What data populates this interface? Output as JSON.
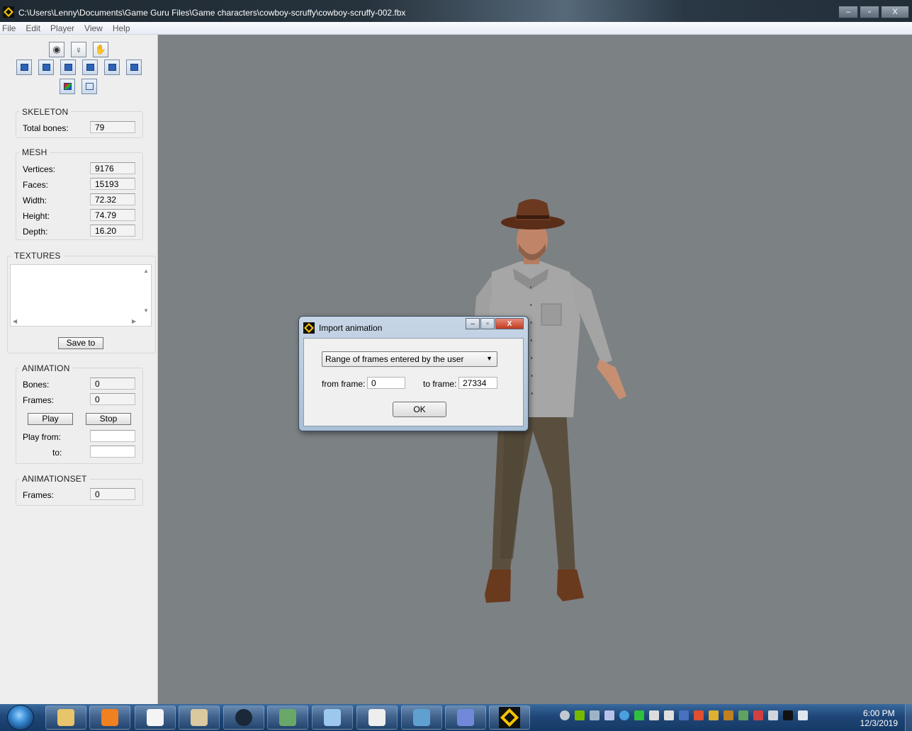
{
  "window": {
    "title": "C:\\Users\\Lenny\\Documents\\Game Guru Files\\Game characters\\cowboy-scruffy\\cowboy-scruffy-002.fbx",
    "minimize_glyph": "–",
    "maximize_glyph": "▫",
    "close_glyph": "X"
  },
  "menu": [
    "File",
    "Edit",
    "Player",
    "View",
    "Help"
  ],
  "toolbar": {
    "row1": [
      "eye-icon",
      "light-icon",
      "hand-icon"
    ],
    "row2": [
      "cube-front-icon",
      "cube-left-icon",
      "cube-right-icon",
      "cube-top-icon",
      "cube-back-icon",
      "cube-bottom-icon"
    ],
    "row3": [
      "cube-color-icon",
      "cube-wire-icon"
    ],
    "row1_glyphs": [
      "◉",
      "♀",
      "✋"
    ]
  },
  "skeleton": {
    "title": "SKELETON",
    "total_bones_label": "Total bones:",
    "total_bones": "79"
  },
  "mesh": {
    "title": "MESH",
    "vertices_label": "Vertices:",
    "vertices": "9176",
    "faces_label": "Faces:",
    "faces": "15193",
    "width_label": "Width:",
    "width": "72.32",
    "height_label": "Height:",
    "height": "74.79",
    "depth_label": "Depth:",
    "depth": "16.20"
  },
  "textures": {
    "title": "TEXTURES",
    "save_label": "Save to"
  },
  "animation": {
    "title": "ANIMATION",
    "bones_label": "Bones:",
    "bones": "0",
    "frames_label": "Frames:",
    "frames": "0",
    "play_label": "Play",
    "stop_label": "Stop",
    "play_from_label": "Play from:",
    "to_label": "to:",
    "play_from": "",
    "to": ""
  },
  "animationset": {
    "title": "ANIMATIONSET",
    "frames_label": "Frames:",
    "frames": "0"
  },
  "dialog": {
    "title": "Import animation",
    "mode": "Range of frames entered by the user",
    "from_label": "from frame:",
    "from_value": "0",
    "to_label": "to frame:",
    "to_value": "27334",
    "ok_label": "OK"
  },
  "taskbar": {
    "apps": [
      "explorer-icon",
      "media-player-icon",
      "notepad-icon",
      "paint-icon",
      "steam-icon",
      "display-icon",
      "control-panel-icon",
      "files-icon",
      "screen-icon",
      "discord-icon",
      "gameguru-icon"
    ],
    "time": "6:00 PM",
    "date": "12/3/2019"
  },
  "colors": {
    "viewport": "#7c8184",
    "panel": "#eeeeee",
    "gameguru_yellow": "#f5c400"
  }
}
